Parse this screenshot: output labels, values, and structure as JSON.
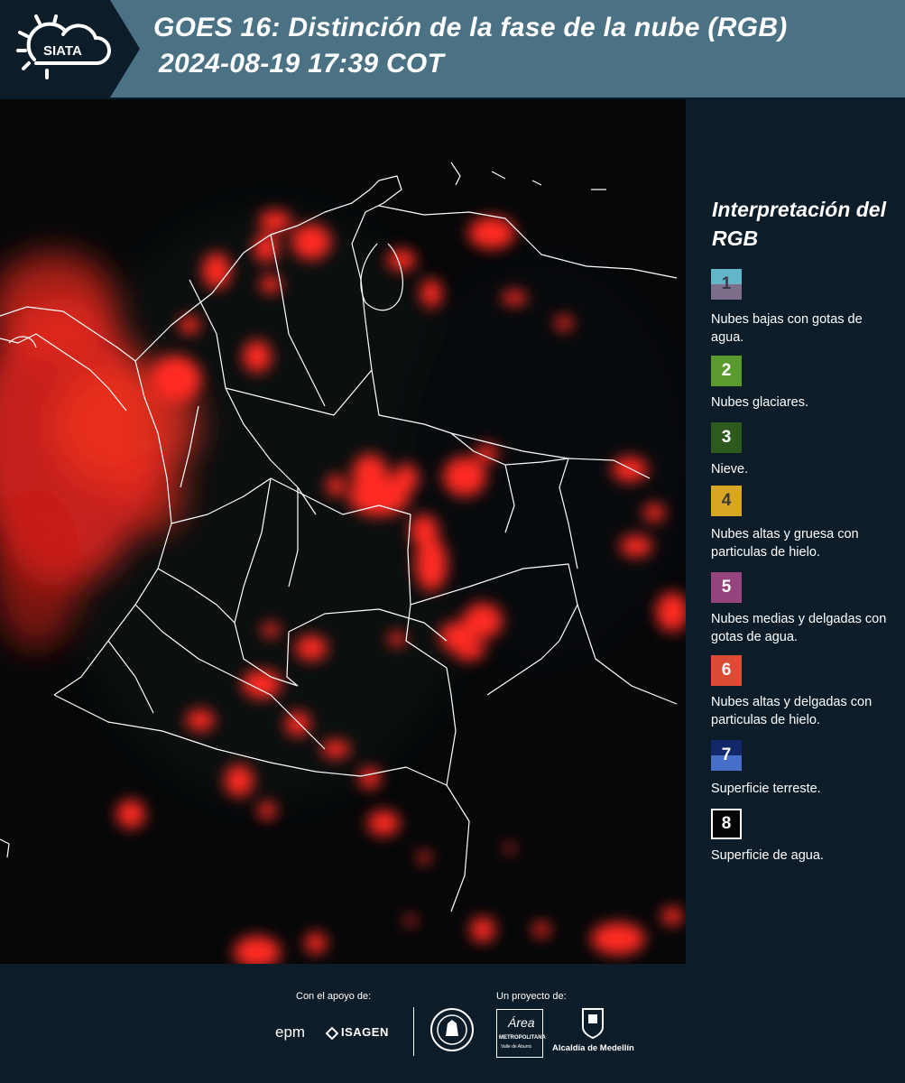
{
  "header": {
    "logo_text": "SIATA",
    "title_line1": "GOES 16: Distinción de la fase de la nube (RGB)",
    "title_line2": "2024-08-19 17:39 COT"
  },
  "legend": {
    "title": "Interpretación del RGB",
    "items": [
      {
        "number": "1",
        "label": "Nubes bajas con gotas de agua.",
        "color_top": "#62b6c8",
        "color_bottom": "#7d6e8c"
      },
      {
        "number": "2",
        "label": "Nubes glaciares.",
        "color_top": "#5a9a2e",
        "color_bottom": "#5a9a2e"
      },
      {
        "number": "3",
        "label": "Nieve.",
        "color_top": "#2e5a1e",
        "color_bottom": "#2e5a1e"
      },
      {
        "number": "4",
        "label": "Nubes altas y gruesa con particulas de hielo.",
        "color_top": "#d7a723",
        "color_bottom": "#d7a723"
      },
      {
        "number": "5",
        "label": "Nubes medias y delgadas con gotas de agua.",
        "color_top": "#96447e",
        "color_bottom": "#96447e"
      },
      {
        "number": "6",
        "label": "Nubes altas y delgadas con particulas de hielo.",
        "color_top": "#dc4b34",
        "color_bottom": "#dc4b34"
      },
      {
        "number": "7",
        "label": "Superficie terreste.",
        "color_top": "#13286a",
        "color_bottom": "#4670c8"
      },
      {
        "number": "8",
        "label": "Superficie de agua.",
        "color_top": "#050505",
        "color_bottom": "#050505"
      }
    ]
  },
  "footer": {
    "support_caption": "Con el apoyo de:",
    "project_caption": "Un proyecto de:",
    "logo_epm": "epm",
    "logo_isagen": "ISAGEN",
    "logo_area_line1": "Área",
    "logo_area_line2": "METROPOLITANA",
    "logo_area_line3": "Valle de Aburrá",
    "logo_alcaldia": "Alcaldía de Medellín"
  },
  "colors": {
    "header_bg": "#4b7284",
    "panel_bg": "#0c1c28",
    "cloud_red": "#ff2a20",
    "border_white": "#ffffff"
  }
}
